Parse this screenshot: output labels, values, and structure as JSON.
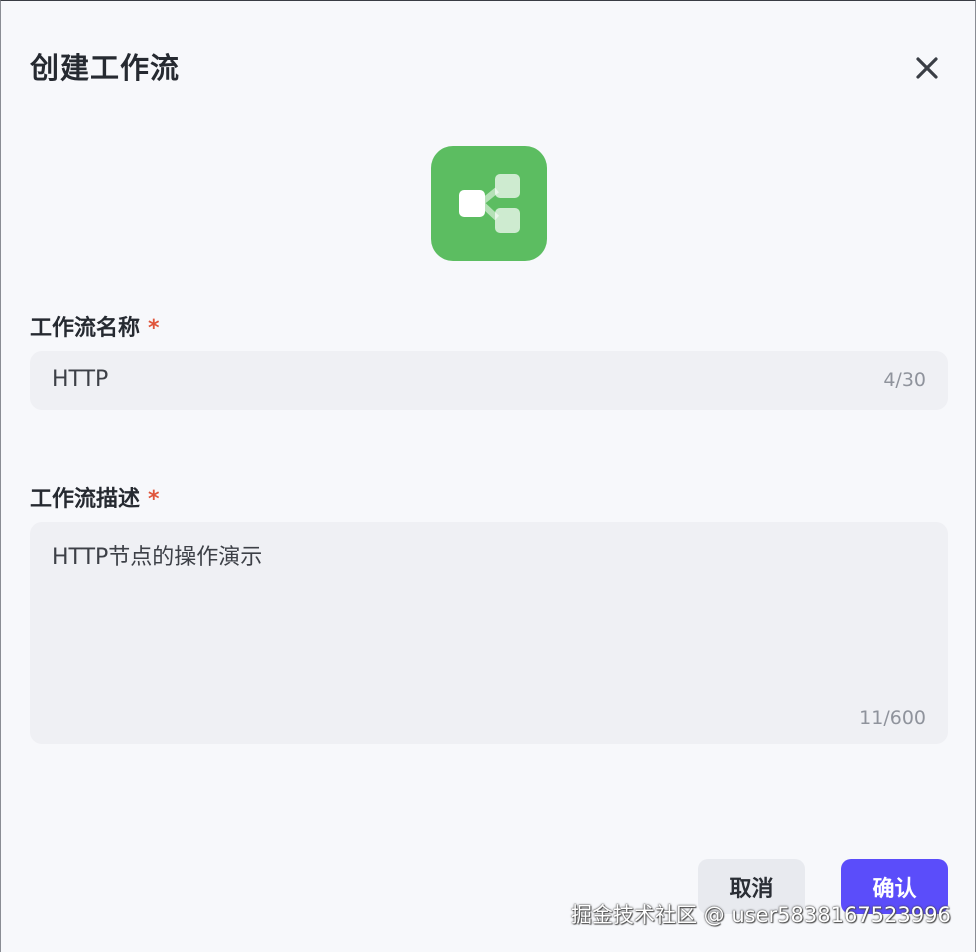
{
  "dialog": {
    "title": "创建工作流",
    "close_icon": "close-icon",
    "app_icon": "workflow-icon",
    "icon_color": "#5cbd61"
  },
  "name_field": {
    "label": "工作流名称",
    "required_mark": "*",
    "value": "HTTP",
    "counter": "4/30"
  },
  "description_field": {
    "label": "工作流描述",
    "required_mark": "*",
    "value": "HTTP节点的操作演示",
    "counter": "11/600"
  },
  "actions": {
    "cancel_label": "取消",
    "confirm_label": "确认",
    "confirm_color": "#5b4dfa"
  },
  "watermark": "掘金技术社区 @ user5838167523996"
}
